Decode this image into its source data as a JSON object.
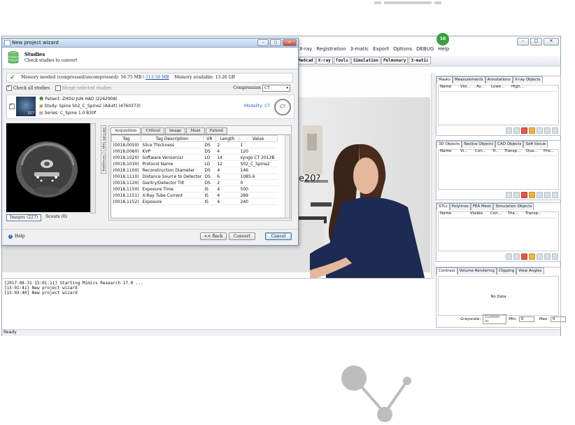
{
  "app": {
    "menu": [
      "X-ray",
      "Registration",
      "3-matic",
      "Export",
      "Options",
      "DEBUG",
      "Help"
    ],
    "toolbar_tabs": [
      "Medcad",
      "X-ray",
      "Tools",
      "Simulation",
      "Pulmonary",
      "3-matic"
    ],
    "badge": "16",
    "viewer_heading": "e20?",
    "log_lines": [
      "[2017-08-31 15:01:11] Starting Mimics Research 17.0 ...",
      "[15:01:41] New project wizard",
      "[15:03:40] New project wizard"
    ],
    "status": "Ready",
    "panels": {
      "masks": {
        "tabs": [
          "Masks",
          "Measurements",
          "Annotations",
          "X-ray Objects"
        ],
        "columns": [
          "Name",
          "Visi...",
          "As...",
          "Lowe...",
          "High..."
        ]
      },
      "objects3d": {
        "tabs": [
          "3D Objects",
          "Reslice Objects",
          "CAD Objects",
          "Soft tissue"
        ],
        "columns": [
          "Name",
          "Vi...",
          "Con...",
          "Tr...",
          "Transp...",
          "Qua...",
          "Pho..."
        ]
      },
      "stls": {
        "tabs": [
          "STLs",
          "Polylines",
          "FEA Mesh",
          "Simulation Objects"
        ],
        "columns": [
          "Name",
          "Visible",
          "Con...",
          "Tria...",
          "Transp..."
        ]
      },
      "contrast": {
        "tabs": [
          "Contrast",
          "Volume Rendering",
          "Clipping",
          "View Angles"
        ],
        "no_data": "No Data",
        "grayscale_label": "Grayscale:",
        "grayscale_value": "Custom sc",
        "min_label": "Min:",
        "min_value": "0",
        "max_label": "Max:",
        "max_value": "0"
      }
    }
  },
  "dialog": {
    "title": "New project wizard",
    "header_title": "Studies",
    "header_subtitle": "Check studies to convert",
    "memory_needed_label": "Memory needed (compressed/uncompressed):",
    "memory_compressed": "56.75 MB",
    "memory_separator": "/",
    "memory_uncompressed": "113.50 MB",
    "memory_available": "Memory available: 13.26 GB",
    "check_all_label": "Check all studies",
    "merge_label": "Merge selected studies",
    "compression_label": "Compression",
    "compression_value": "CT",
    "patient": "Patient: ZHOU JUN HAO (2262908)",
    "study": "Study: Spine S02_C_Spine2 (Adult) (4760373)",
    "series": "Series: C_Spine  1.0  B30f",
    "thumb_count": "227",
    "modality": "Modality: CT",
    "ct_badge": "CT",
    "image_tabs": [
      "Images (227)",
      "Scouts (0)"
    ],
    "side_tabs": [
      "DICOM tags",
      "Grouping"
    ],
    "tag_tabs": [
      "Acquisition",
      "Critical",
      "Image",
      "Main",
      "Patient"
    ],
    "table_headers": [
      "Tag",
      "Tag Description",
      "VR",
      "Length",
      "Value"
    ],
    "rows": [
      [
        "(0018,0050)",
        "Slice Thickness",
        "DS",
        "2",
        "1"
      ],
      [
        "(0018,0060)",
        "KVP",
        "DS",
        "4",
        "120"
      ],
      [
        "(0018,1020)",
        "Software Version(s)",
        "LO",
        "14",
        "syngo CT 2012B"
      ],
      [
        "(0018,1030)",
        "Protocol Name",
        "LO",
        "12",
        "S02_C_Spine2"
      ],
      [
        "(0018,1100)",
        "Reconstruction Diameter",
        "DS",
        "4",
        "146"
      ],
      [
        "(0018,1110)",
        "Distance Source to Detector",
        "DS",
        "6",
        "1085.6"
      ],
      [
        "(0018,1120)",
        "Gantry/Detector Tilt",
        "DS",
        "2",
        "0"
      ],
      [
        "(0018,1150)",
        "Exposure Time",
        "IS",
        "4",
        "500"
      ],
      [
        "(0018,1151)",
        "X-Ray Tube Current",
        "IS",
        "4",
        "289"
      ],
      [
        "(0018,1152)",
        "Exposure",
        "IS",
        "4",
        "240"
      ]
    ],
    "help_label": "Help",
    "back_label": "<< Back",
    "convert_label": "Convert",
    "cancel_label": "Cancel"
  },
  "colors": {
    "accent_blue": "#1e3f8a",
    "success_green": "#2f9a2f",
    "modality_blue": "#2a63c6"
  }
}
